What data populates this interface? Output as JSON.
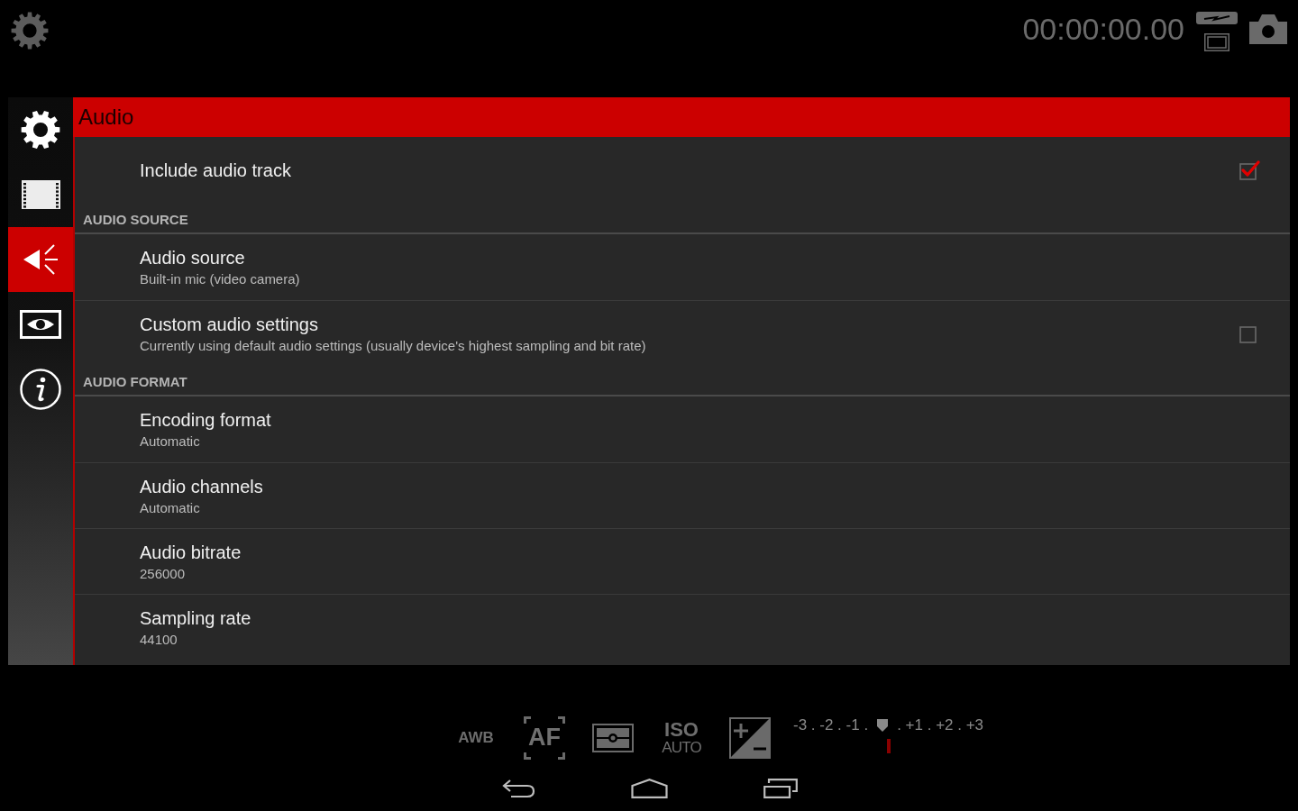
{
  "top_bar": {
    "timer": "00:00:00.00"
  },
  "sidebar": {
    "tabs": [
      {
        "kind": "general",
        "selected": false
      },
      {
        "kind": "video",
        "selected": false
      },
      {
        "kind": "audio",
        "selected": true
      },
      {
        "kind": "display",
        "selected": false
      },
      {
        "kind": "about",
        "selected": false
      }
    ]
  },
  "panel": {
    "title": "Audio",
    "items": [
      {
        "kind": "checkbox",
        "title": "Include audio track",
        "checked": true
      },
      {
        "kind": "section",
        "title": "AUDIO SOURCE"
      },
      {
        "kind": "value",
        "title": "Audio source",
        "summary": "Built-in mic (video camera)"
      },
      {
        "kind": "checkbox",
        "title": "Custom audio settings",
        "summary": "Currently using default audio settings (usually device's highest sampling and bit rate)",
        "checked": false
      },
      {
        "kind": "section",
        "title": "AUDIO FORMAT"
      },
      {
        "kind": "value",
        "title": "Encoding format",
        "summary": "Automatic"
      },
      {
        "kind": "value",
        "title": "Audio channels",
        "summary": "Automatic"
      },
      {
        "kind": "value",
        "title": "Audio bitrate",
        "summary": "256000"
      },
      {
        "kind": "value",
        "title": "Sampling rate",
        "summary": "44100"
      }
    ]
  },
  "camera_controls": {
    "white_balance": "AWB",
    "focus": "AF",
    "iso": {
      "top": "ISO",
      "bottom": "AUTO"
    },
    "exposure_scale": {
      "left": "-3 . -2 . -1 .",
      "right": ". +1 . +2 . +3",
      "level": 0.5
    }
  }
}
